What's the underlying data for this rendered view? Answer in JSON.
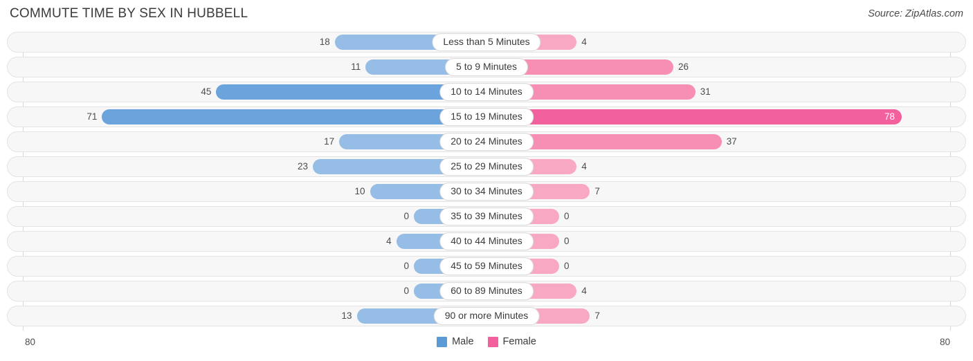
{
  "header": {
    "title": "COMMUTE TIME BY SEX IN HUBBELL",
    "source": "Source: ZipAtlas.com"
  },
  "axis": {
    "left_tick": "80",
    "right_tick": "80"
  },
  "legend": {
    "items": [
      {
        "label": "Male",
        "color": "#5b9bd5"
      },
      {
        "label": "Female",
        "color": "#f2609e"
      }
    ]
  },
  "colors": {
    "male_light": "#96bde5",
    "male_dark": "#6ba3dc",
    "male_max": "#4a90d9",
    "female_light": "#f9a8c4",
    "female_mid": "#f78eb4",
    "female_max": "#f2609e",
    "track_bg": "#f7f7f7",
    "track_border": "#e3e3e3"
  },
  "chart_data": {
    "type": "bar",
    "orientation": "horizontal-diverging",
    "title": "COMMUTE TIME BY SEX IN HUBBELL",
    "xlabel": "",
    "ylabel": "",
    "axis_max": 80,
    "xlim": [
      80,
      80
    ],
    "grid": false,
    "legend_position": "bottom-center",
    "categories": [
      "Less than 5 Minutes",
      "5 to 9 Minutes",
      "10 to 14 Minutes",
      "15 to 19 Minutes",
      "20 to 24 Minutes",
      "25 to 29 Minutes",
      "30 to 34 Minutes",
      "35 to 39 Minutes",
      "40 to 44 Minutes",
      "45 to 59 Minutes",
      "60 to 89 Minutes",
      "90 or more Minutes"
    ],
    "series": [
      {
        "name": "Male",
        "values": [
          18,
          11,
          45,
          71,
          17,
          23,
          10,
          0,
          4,
          0,
          0,
          13
        ]
      },
      {
        "name": "Female",
        "values": [
          4,
          26,
          31,
          78,
          37,
          4,
          7,
          0,
          0,
          0,
          4,
          7
        ]
      }
    ]
  },
  "rows": [
    {
      "label": "Less than 5 Minutes",
      "male": "18",
      "female": "4"
    },
    {
      "label": "5 to 9 Minutes",
      "male": "11",
      "female": "26"
    },
    {
      "label": "10 to 14 Minutes",
      "male": "45",
      "female": "31"
    },
    {
      "label": "15 to 19 Minutes",
      "male": "71",
      "female": "78"
    },
    {
      "label": "20 to 24 Minutes",
      "male": "17",
      "female": "37"
    },
    {
      "label": "25 to 29 Minutes",
      "male": "23",
      "female": "4"
    },
    {
      "label": "30 to 34 Minutes",
      "male": "10",
      "female": "7"
    },
    {
      "label": "35 to 39 Minutes",
      "male": "0",
      "female": "0"
    },
    {
      "label": "40 to 44 Minutes",
      "male": "4",
      "female": "0"
    },
    {
      "label": "45 to 59 Minutes",
      "male": "0",
      "female": "0"
    },
    {
      "label": "60 to 89 Minutes",
      "male": "0",
      "female": "4"
    },
    {
      "label": "90 or more Minutes",
      "male": "13",
      "female": "7"
    }
  ]
}
